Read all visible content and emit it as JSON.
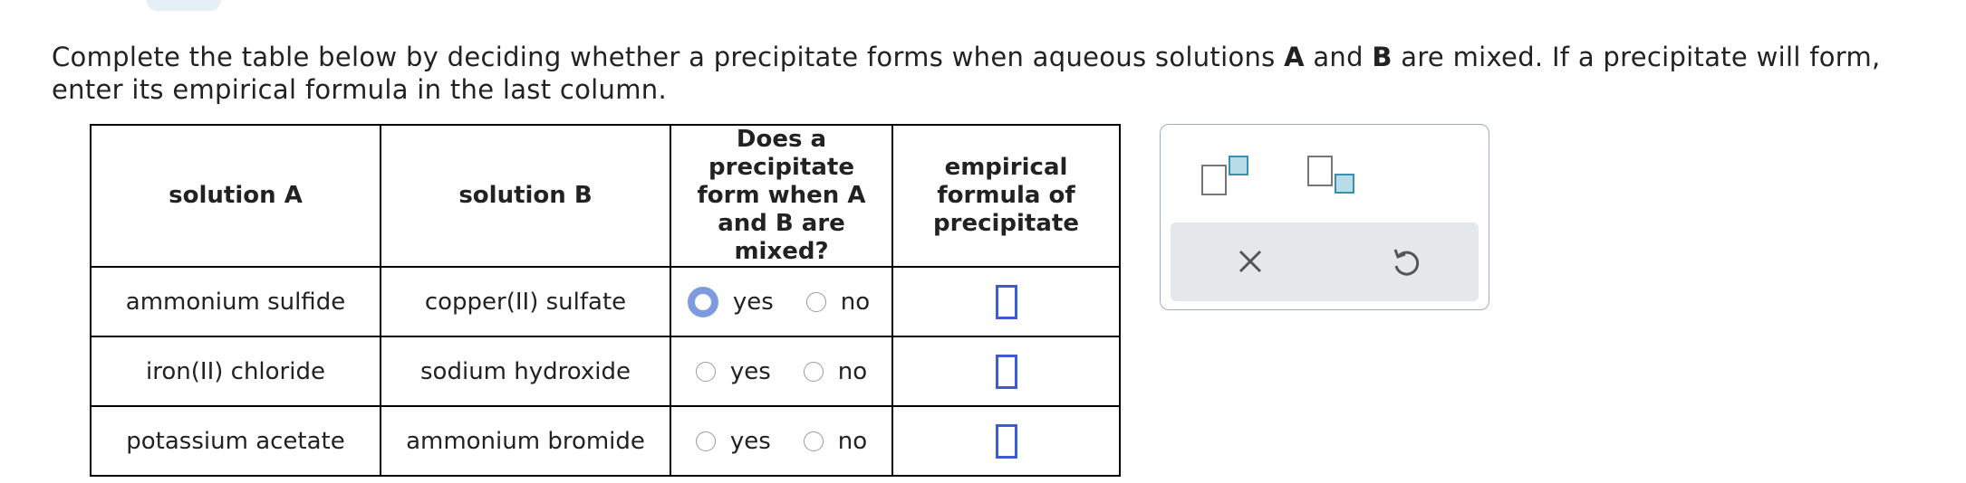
{
  "prompt": {
    "part1": "Complete the table below by deciding whether a precipitate forms when aqueous solutions ",
    "bold_a": "A",
    "part2": " and ",
    "bold_b": "B",
    "part3": " are mixed. If a precipitate will form, enter its empirical formula in the last column."
  },
  "table": {
    "headers": {
      "solution_a": "solution A",
      "solution_b": "solution B",
      "precipitate_q": "Does a precipitate form when A and B are mixed?",
      "formula": "empirical formula of precipitate"
    },
    "rows": [
      {
        "solution_a": "ammonium sulfide",
        "solution_b": "copper(II) sulfate",
        "yes": "yes",
        "no": "no",
        "formula": ""
      },
      {
        "solution_a": "iron(II) chloride",
        "solution_b": "sodium hydroxide",
        "yes": "yes",
        "no": "no",
        "formula": ""
      },
      {
        "solution_a": "potassium acetate",
        "solution_b": "ammonium bromide",
        "yes": "yes",
        "no": "no",
        "formula": ""
      }
    ]
  },
  "panel": {
    "tools": [
      "superscript-icon",
      "subscript-icon"
    ],
    "actions": [
      "clear-icon",
      "undo-icon"
    ]
  },
  "colors": {
    "input_border": "#3b5bdb",
    "focus_ring": "#7f9be0",
    "panel_bar": "#e4e8eb",
    "tool_accent": "#b8dde8"
  }
}
